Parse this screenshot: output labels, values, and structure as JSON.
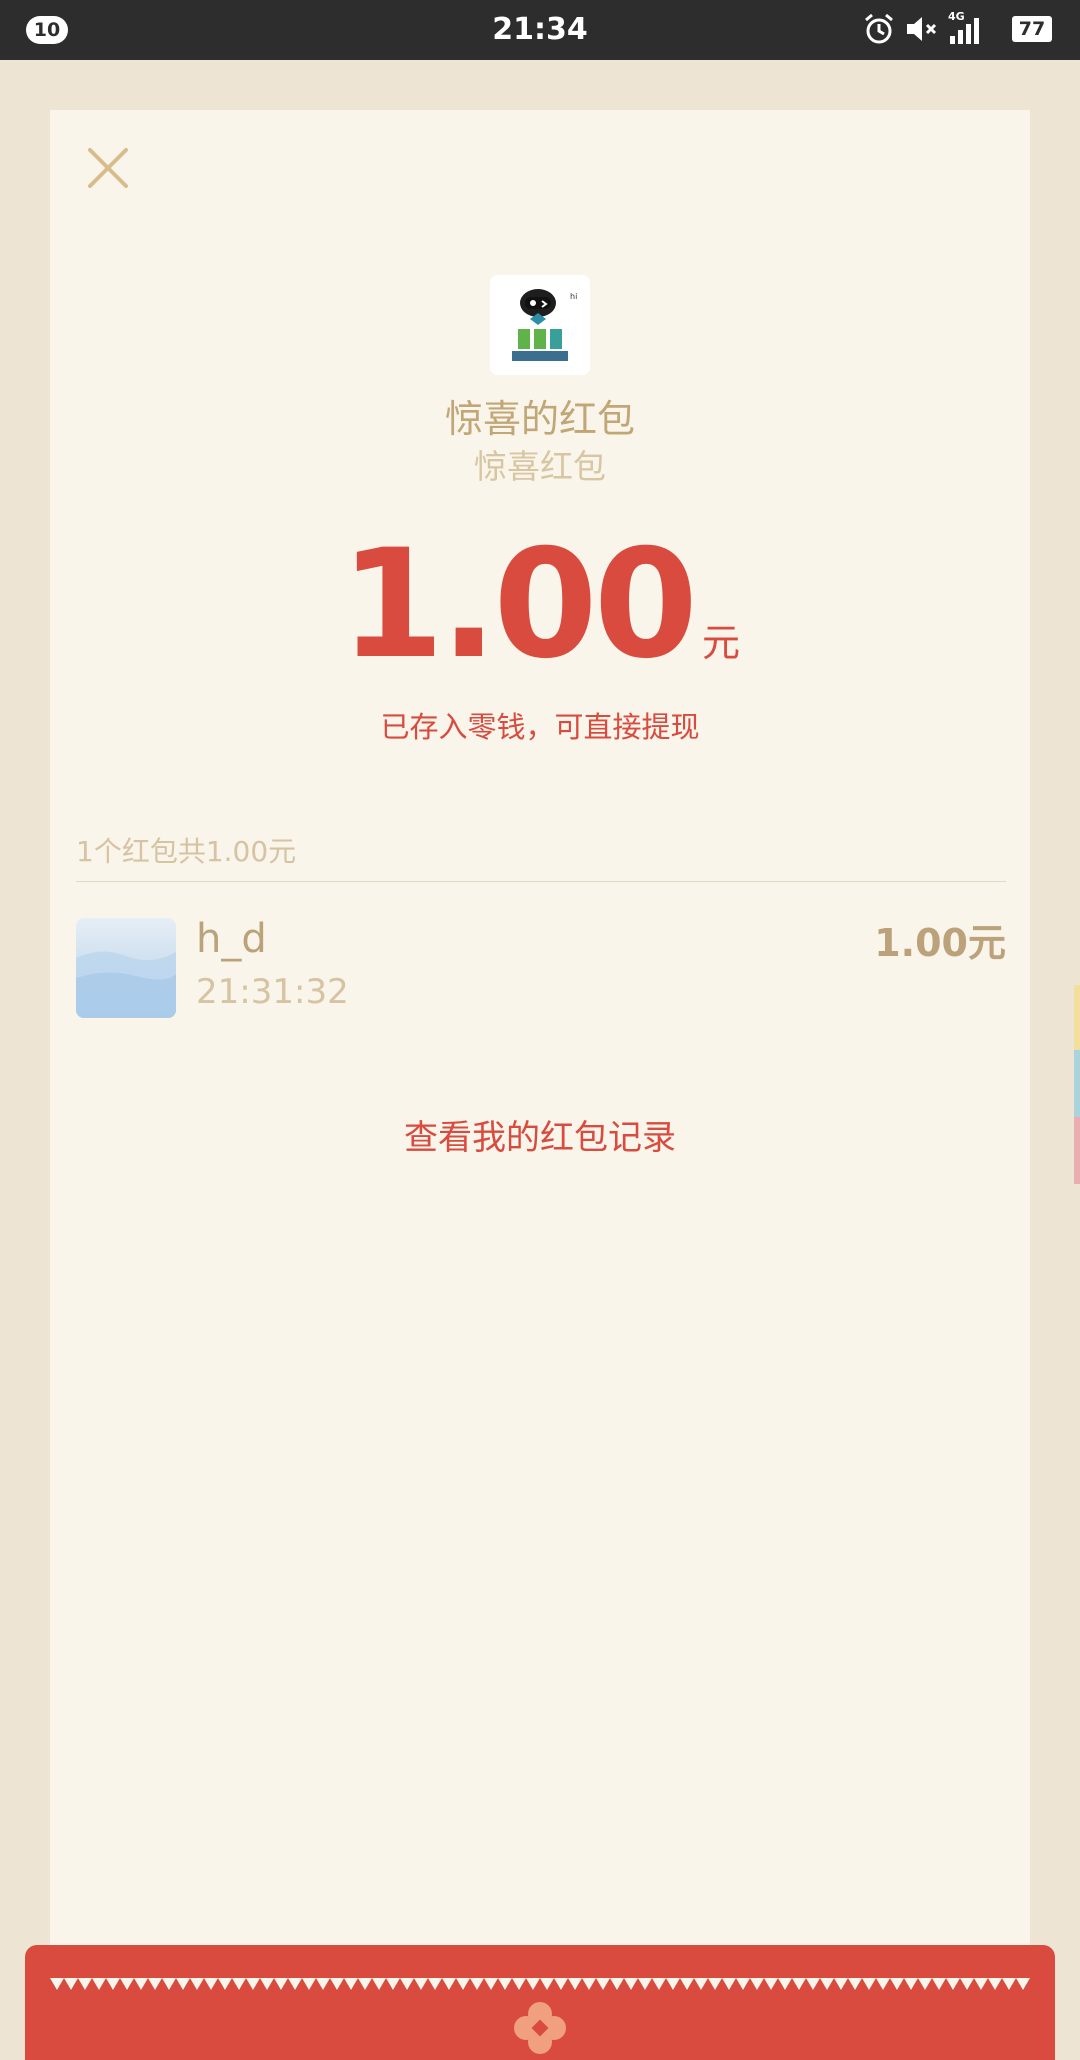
{
  "status_bar": {
    "notifications": "10",
    "time": "21:34",
    "network": "4G",
    "battery": "77"
  },
  "red_packet": {
    "sender_name": "惊喜的红包",
    "greeting": "惊喜红包",
    "amount": "1.00",
    "unit": "元",
    "deposit_note": "已存入零钱，可直接提现",
    "summary": "1个红包共1.00元",
    "receiver": {
      "name": "h_d",
      "time": "21:31:32",
      "amount": "1.00元"
    },
    "history_link": "查看我的红包记录"
  },
  "colors": {
    "accent_red": "#d94b3f",
    "gold": "#c1a676",
    "background": "#ede4d3",
    "sheet": "#f9f5ea"
  }
}
